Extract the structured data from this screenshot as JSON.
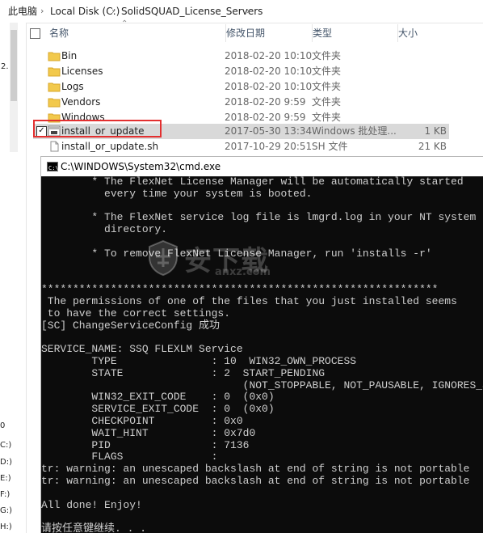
{
  "breadcrumb": {
    "cut_prefix": "此电脑",
    "segments": [
      "Local Disk (C:)",
      "SolidSQUAD_License_Servers"
    ],
    "separator": "›"
  },
  "left_nav": {
    "fragments": [
      "2.",
      "0",
      "C:)",
      "D:)",
      "E:)",
      "F:)",
      "G:)",
      "H:)"
    ]
  },
  "columns": {
    "name": "名称",
    "date": "修改日期",
    "type": "类型",
    "size": "大小"
  },
  "rows": [
    {
      "name": "Bin",
      "date": "2018-02-20 10:10",
      "type": "文件夹",
      "size": "",
      "icon": "folder-icon"
    },
    {
      "name": "Licenses",
      "date": "2018-02-20 10:10",
      "type": "文件夹",
      "size": "",
      "icon": "folder-icon"
    },
    {
      "name": "Logs",
      "date": "2018-02-20 10:10",
      "type": "文件夹",
      "size": "",
      "icon": "folder-icon"
    },
    {
      "name": "Vendors",
      "date": "2018-02-20 9:59",
      "type": "文件夹",
      "size": "",
      "icon": "folder-icon"
    },
    {
      "name": "Windows",
      "date": "2018-02-20 9:59",
      "type": "文件夹",
      "size": "",
      "icon": "folder-icon"
    },
    {
      "name": "install_or_update",
      "date": "2017-05-30 13:34",
      "type": "Windows 批处理...",
      "size": "1 KB",
      "icon": "batch-file-icon",
      "selected": true,
      "checked": true
    },
    {
      "name": "install_or_update.sh",
      "date": "2017-10-29 20:51",
      "type": "SH 文件",
      "size": "21 KB",
      "icon": "sh-file-icon"
    }
  ],
  "console": {
    "title": "C:\\WINDOWS\\System32\\cmd.exe",
    "lines": [
      "        * The FlexNet License Manager will be automatically started",
      "          every time your system is booted.",
      "",
      "        * The FlexNet service log file is lmgrd.log in your NT system",
      "          directory.",
      "",
      "        * To remove FlexNet License Manager, run 'installs -r'",
      "",
      "",
      "***************************************************************",
      " The permissions of one of the files that you just installed seems",
      " to have the correct settings.",
      "[SC] ChangeServiceConfig 成功",
      "",
      "SERVICE_NAME: SSQ FLEXLM Service",
      "        TYPE               : 10  WIN32_OWN_PROCESS",
      "        STATE              : 2  START_PENDING",
      "                                (NOT_STOPPABLE, NOT_PAUSABLE, IGNORES_SHUTDOWN)",
      "        WIN32_EXIT_CODE    : 0  (0x0)",
      "        SERVICE_EXIT_CODE  : 0  (0x0)",
      "        CHECKPOINT         : 0x0",
      "        WAIT_HINT          : 0x7d0",
      "        PID                : 7136",
      "        FLAGS              :",
      "tr: warning: an unescaped backslash at end of string is not portable",
      "tr: warning: an unescaped backslash at end of string is not portable",
      "",
      "All done! Enjoy!",
      "",
      "请按任意键继续. . ."
    ]
  },
  "watermark": {
    "main_text": "安下载",
    "sub_text": "anxz.com"
  },
  "colors": {
    "selected_row": "#d9d9d9",
    "highlight_border": "#e32f2f",
    "folder": "#f2c94c",
    "console_bg": "#0c0c0c",
    "console_text": "#cfcfcf"
  }
}
